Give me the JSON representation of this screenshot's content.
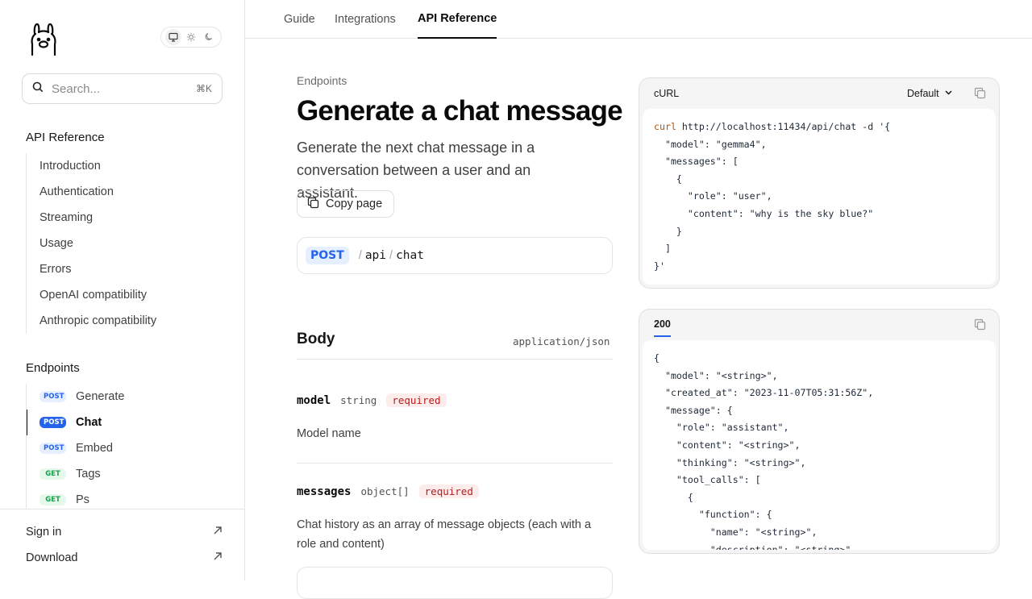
{
  "sidebar": {
    "search": {
      "placeholder": "Search...",
      "shortcut": "⌘K"
    },
    "sections": [
      {
        "title": "API Reference",
        "items": [
          "Introduction",
          "Authentication",
          "Streaming",
          "Usage",
          "Errors",
          "OpenAI compatibility",
          "Anthropic compatibility"
        ]
      },
      {
        "title": "Endpoints",
        "items": [
          {
            "method": "POST",
            "label": "Generate"
          },
          {
            "method": "POST",
            "label": "Chat",
            "active": true
          },
          {
            "method": "POST",
            "label": "Embed"
          },
          {
            "method": "GET",
            "label": "Tags"
          },
          {
            "method": "GET",
            "label": "Ps"
          }
        ]
      }
    ],
    "footer": {
      "sign_in": "Sign in",
      "download": "Download"
    }
  },
  "topnav": {
    "tabs": [
      "Guide",
      "Integrations",
      "API Reference"
    ],
    "active": "API Reference"
  },
  "page": {
    "breadcrumb": "Endpoints",
    "title": "Generate a chat message",
    "description": "Generate the next chat message in a conversation between a user and an assistant.",
    "copy_page": "Copy page",
    "endpoint": {
      "method": "POST",
      "path": [
        "api",
        "chat"
      ]
    }
  },
  "body": {
    "title": "Body",
    "content_type": "application/json",
    "fields": [
      {
        "name": "model",
        "type": "string",
        "required": "required",
        "description": "Model name"
      },
      {
        "name": "messages",
        "type": "object[]",
        "required": "required",
        "description": "Chat history as an array of message objects (each with a role and content)"
      }
    ]
  },
  "request_panel": {
    "language": "cURL",
    "variant": "Default",
    "code": [
      "curl http://localhost:11434/api/chat -d '{",
      "  \"model\": \"gemma4\",",
      "  \"messages\": [",
      "    {",
      "      \"role\": \"user\",",
      "      \"content\": \"why is the sky blue?\"",
      "    }",
      "  ]",
      "}'"
    ]
  },
  "response_panel": {
    "status": "200",
    "code": [
      "{",
      "  \"model\": \"<string>\",",
      "  \"created_at\": \"2023-11-07T05:31:56Z\",",
      "  \"message\": {",
      "    \"role\": \"assistant\",",
      "    \"content\": \"<string>\",",
      "    \"thinking\": \"<string>\",",
      "    \"tool_calls\": [",
      "      {",
      "        \"function\": {",
      "          \"name\": \"<string>\",",
      "          \"description\": \"<string>\","
    ]
  },
  "colors": {
    "accent": "#2563eb",
    "get": "#16a34a",
    "required": "#b91c1c"
  }
}
